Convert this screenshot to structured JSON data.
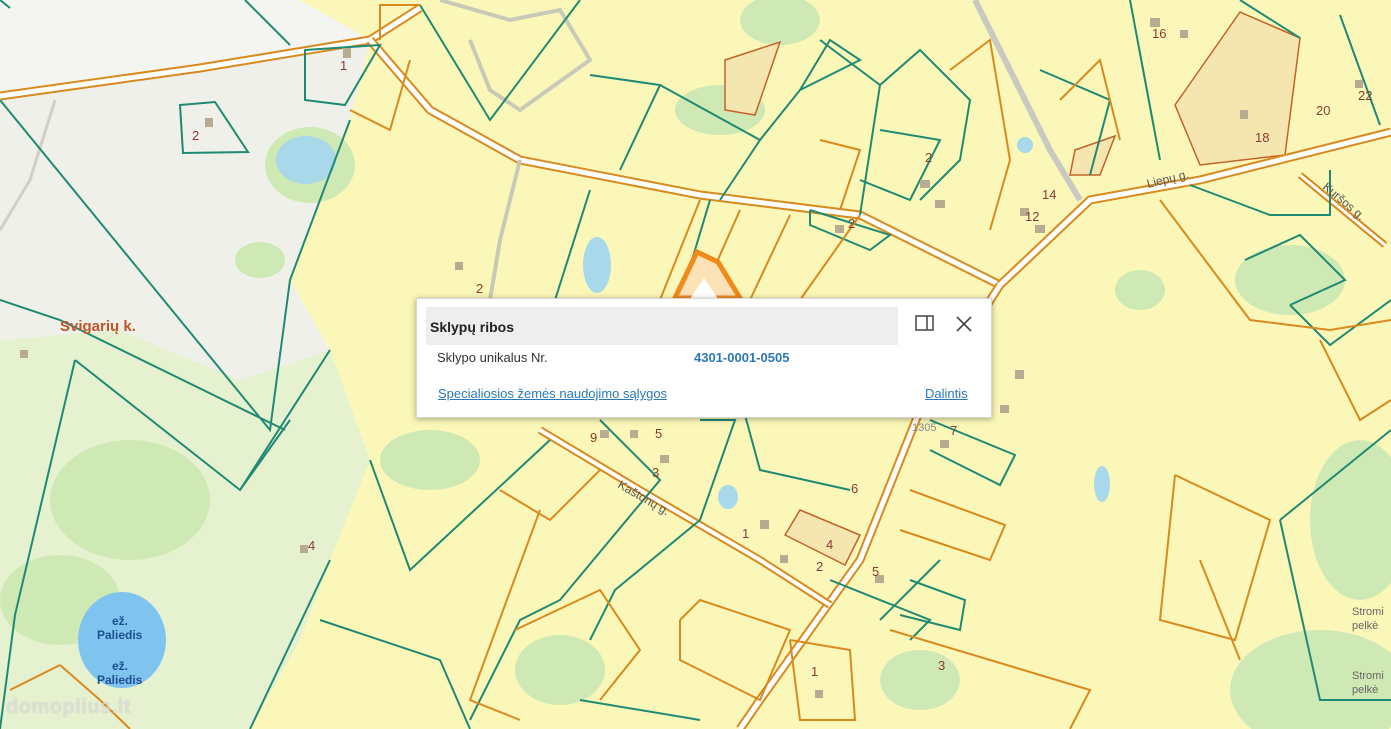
{
  "map": {
    "places": {
      "village": "Svigarių k.",
      "lake_prefix": "ež.",
      "lake_name": "Paliedis",
      "street_liepu": "Liepų g.",
      "street_kursos": "Kuršos g.",
      "street_kastoniu": "Kaštonų g.",
      "wetland_1": "Stromi",
      "wetland_1b": "pelkė",
      "wetland_2": "Stromi",
      "wetland_2b": "pelkė",
      "road_number": "1305"
    },
    "house_numbers": [
      "1",
      "2",
      "2",
      "16",
      "22",
      "18",
      "20",
      "2",
      "14",
      "12",
      "2",
      "9",
      "5",
      "3",
      "7",
      "6",
      "1",
      "4",
      "2",
      "5",
      "4",
      "1",
      "3"
    ]
  },
  "popup": {
    "title": "Sklypų ribos",
    "field_label": "Sklypo unikalus Nr.",
    "field_value": "4301-0001-0505",
    "link_conditions": "Specialiosios žemės naudojimo sąlygos",
    "link_share": "Dalintis",
    "dock_icon": "dock-panel-icon",
    "close_icon": "close-icon"
  },
  "watermark": "domoplius.lt",
  "colors": {
    "parcel_teal": "#1f8a74",
    "parcel_orange": "#d98a1e",
    "selected_parcel": "#f08a1a",
    "settlement_yellow": "#fbf7b8",
    "forest_green": "#cfe9b4",
    "water_blue": "#a8d8ea",
    "link_blue": "#2a78b8"
  }
}
